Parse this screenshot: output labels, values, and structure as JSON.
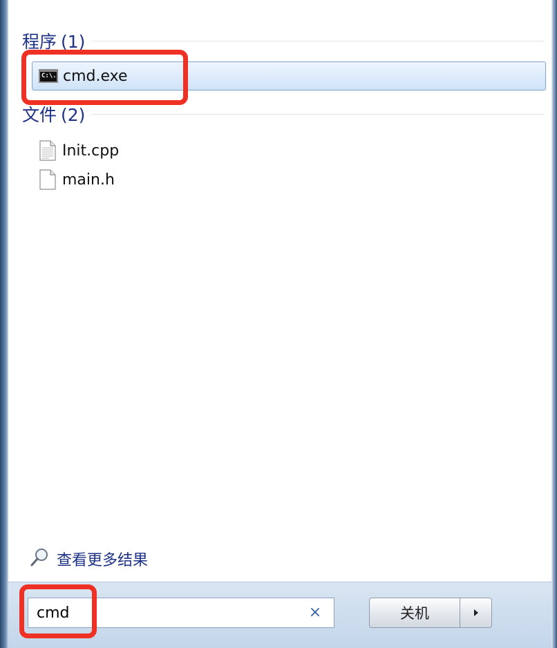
{
  "groups": {
    "programs": {
      "title": "程序",
      "count": "(1)",
      "items": [
        {
          "label": "cmd.exe",
          "icon": "console-icon"
        }
      ]
    },
    "files": {
      "title": "文件",
      "count": "(2)",
      "items": [
        {
          "label": "Init.cpp",
          "icon": "text-file-icon"
        },
        {
          "label": "main.h",
          "icon": "blank-file-icon"
        }
      ]
    }
  },
  "see_more": {
    "label": "查看更多结果",
    "icon": "magnifier-icon"
  },
  "search": {
    "value": "cmd",
    "clear_icon": "clear-icon"
  },
  "shutdown": {
    "label": "关机",
    "arrow_icon": "arrow-right-icon"
  },
  "icon_text": {
    "console": "C:\\."
  },
  "colors": {
    "group_title": "#1e3287",
    "highlight": "#ee3124",
    "selected_fill": "#cfe3f8",
    "selected_border": "#7da2ce",
    "bottom_bar": "#c3d6ea"
  }
}
